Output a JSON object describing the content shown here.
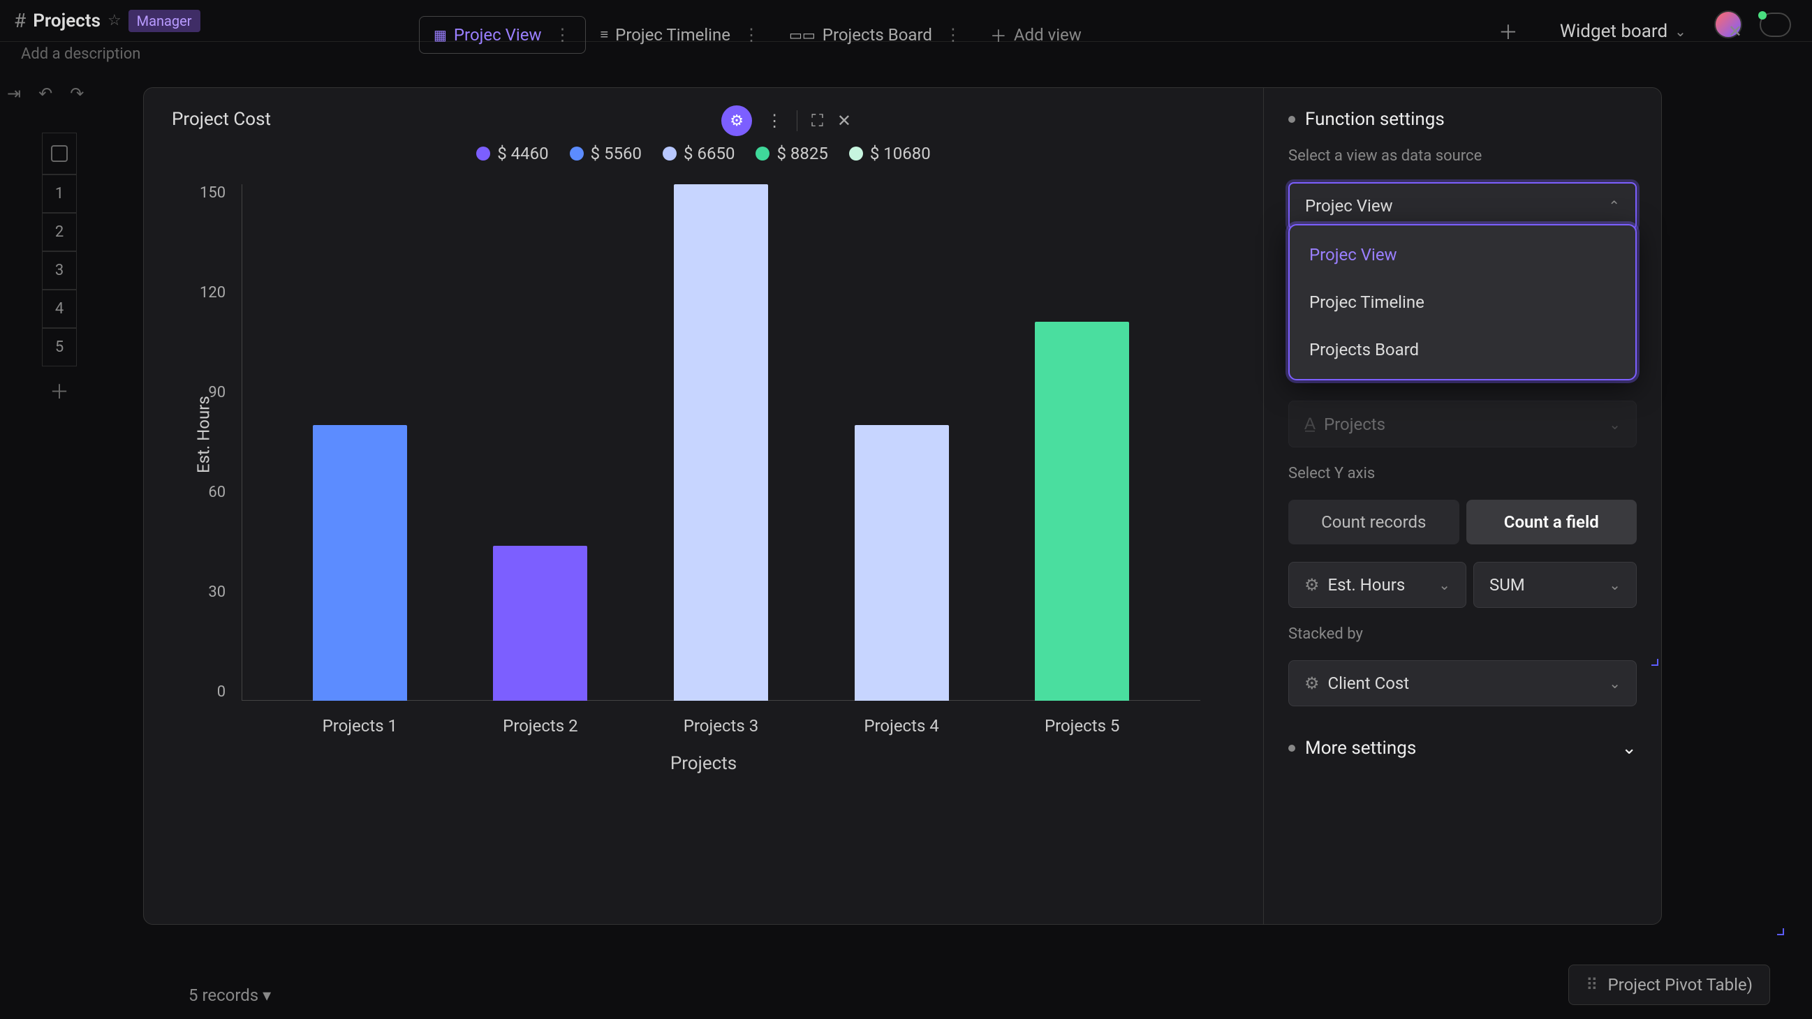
{
  "page": {
    "title": "Projects",
    "badge": "Manager",
    "description_placeholder": "Add a description"
  },
  "tabs": [
    {
      "label": "Projec View",
      "active": true
    },
    {
      "label": "Projec Timeline",
      "active": false
    },
    {
      "label": "Projects Board",
      "active": false
    }
  ],
  "add_view_label": "Add view",
  "widget_board_label": "Widget board",
  "rows": [
    "1",
    "2",
    "3",
    "4",
    "5"
  ],
  "records_footer": "5 records ▾",
  "pivot_footer": "Project Pivot Table)",
  "modal": {
    "title": "Project Cost",
    "toolbar": {
      "gear": "⚙",
      "expand": "⛶",
      "close": "✕"
    }
  },
  "settings": {
    "header": "Function settings",
    "data_source_label": "Select a view as data source",
    "data_source_value": "Projec View",
    "data_source_options": [
      "Projec View",
      "Projec Timeline",
      "Projects Board"
    ],
    "x_axis_hidden": "Projects",
    "y_axis_label": "Select Y axis",
    "y_toggle": {
      "left": "Count records",
      "right": "Count a field"
    },
    "y_field": "Est. Hours",
    "y_agg": "SUM",
    "stacked_label": "Stacked by",
    "stacked_value": "Client Cost",
    "more_label": "More settings"
  },
  "chart_data": {
    "type": "bar",
    "title": "Project Cost",
    "xlabel": "Projects",
    "ylabel": "Est. Hours",
    "ylim": [
      0,
      150
    ],
    "yticks": [
      0,
      30,
      60,
      90,
      120,
      150
    ],
    "categories": [
      "Projects 1",
      "Projects 2",
      "Projects 3",
      "Projects 4",
      "Projects 5"
    ],
    "values": [
      80,
      45,
      150,
      80,
      110
    ],
    "colors": [
      "#5c8cff",
      "#7c5fff",
      "#c7d5ff",
      "#c7d5ff",
      "#4ade9f"
    ],
    "legend": [
      {
        "label": "$ 4460",
        "color": "#7c5fff"
      },
      {
        "label": "$ 5560",
        "color": "#5c8cff"
      },
      {
        "label": "$ 6650",
        "color": "#b8c8ff"
      },
      {
        "label": "$ 8825",
        "color": "#3fd89a"
      },
      {
        "label": "$ 10680",
        "color": "#c7f5df"
      }
    ]
  }
}
